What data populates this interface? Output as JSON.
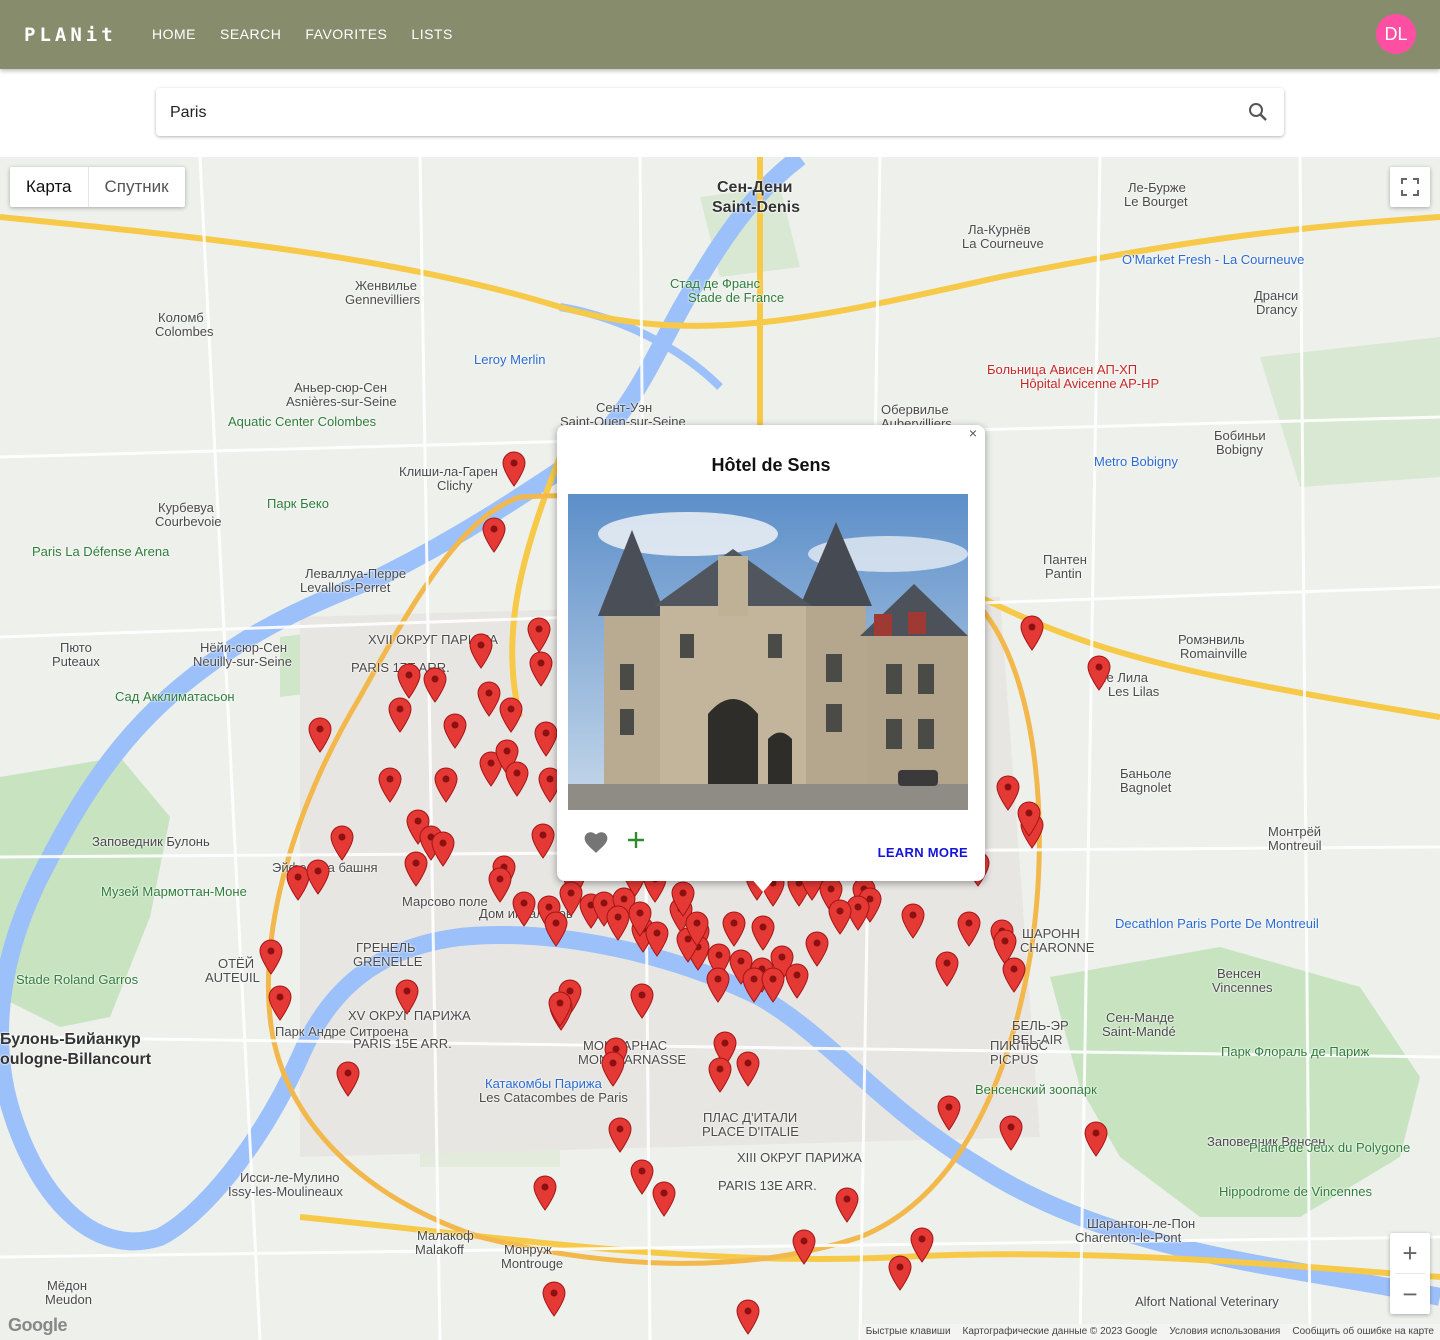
{
  "app": {
    "logo": "PLANit"
  },
  "nav": {
    "items": [
      "HOME",
      "SEARCH",
      "FAVORITES",
      "LISTS"
    ]
  },
  "user": {
    "initials": "DL",
    "avatar_color": "#ff4fa3"
  },
  "search": {
    "value": "Paris"
  },
  "map": {
    "type_buttons": [
      "Карта",
      "Спутник"
    ],
    "active_type": "Карта",
    "attribution": [
      "Быстрые клавиши",
      "Картографические данные © 2023 Google",
      "Условия использования",
      "Сообщить об ошибке на карте"
    ],
    "google_logo": "Google",
    "labels": [
      "Сен-Дени",
      "Saint-Denis",
      "Ле-Бурже",
      "Le Bourget",
      "Ла-Курнёв",
      "La Courneuve",
      "Женвилье",
      "Gennevilliers",
      "Коломб",
      "Colombes",
      "Аньер-сюр-Сен",
      "Asnières-sur-Seine",
      "Сент-Уэн",
      "Saint-Ouen-sur-Seine",
      "Клиши-ла-Гарен",
      "Clichy",
      "Курбевуа",
      "Courbevoie",
      "Леваллуа-Перре",
      "Levallois-Perret",
      "Нёйи-сюр-Сен",
      "Neuilly-sur-Seine",
      "Пюто",
      "Puteaux",
      "Обервилье",
      "Aubervilliers",
      "Бобиньи",
      "Bobigny",
      "Дранси",
      "Drancy",
      "Пантен",
      "Pantin",
      "Ромэнвиль",
      "Romainville",
      "Ле Лила",
      "Les Lilas",
      "Баньоле",
      "Bagnolet",
      "Монтрёй",
      "Montreuil",
      "Венсен",
      "Vincennes",
      "Сен-Манде",
      "Saint-Mandé",
      "Шарантон-ле-Пон",
      "Charenton-le-Pont",
      "Исси-ле-Мулино",
      "Issy-les-Moulineaux",
      "Малакоф",
      "Malakoff",
      "Монруж",
      "Montrouge",
      "Мёдон",
      "Meudon",
      "Булонь-Бийанкур",
      "oulogne-Billancourt",
      "XV ОКРУГ ПАРИЖА",
      "PARIS 15E ARR.",
      "XVII ОКРУГ ПАРИЖА",
      "PARIS 17E ARR.",
      "XIII ОКРУГ ПАРИЖА",
      "PARIS 13E ARR.",
      "ПЛАС Д'ИТАЛИ",
      "PLACE D'ITALIE",
      "МОНПАРНАС",
      "MONTPARNASSE",
      "ГРЕНЕЛЬ",
      "GRENELLE",
      "ОТЁЙ",
      "AUTEUIL",
      "ШАРОНН",
      "CHARONNE",
      "ПИКПЮС",
      "PICPUS",
      "БЕЛЬ-ЭР",
      "BEL-AIR",
      "Заповедник Булонь",
      "Заповедник Венсен",
      "Эйфелева башня",
      "Марсово поле",
      "Дом инвалидов",
      "Катакомбы Парижа",
      "Les Catacombes de Paris",
      "Венсенский зоопарк",
      "Парк Флораль де Париж",
      "Plaine de Jeux du Polygone",
      "Hippodrome de Vincennes",
      "Aquatic Center Colombes",
      "Paris La Défense Arena",
      "Stade Roland Garros",
      "Сад Акклиматасьон",
      "Музей Мармоттан-Моне",
      "Парк Беко",
      "Стад де Франс",
      "Stade de France",
      "Больница Ависен АП-ХП",
      "Hôpital Avicenne AP-HP",
      "Leroy Merlin",
      "Decathlon Paris Porte De Montreuil",
      "O'Market Fresh - La Courneuve",
      "Metro Bobigny",
      "Парк Андре Ситроена",
      "Alfort National Veterinary"
    ]
  },
  "popup": {
    "title": "Hôtel de Sens",
    "close": "×",
    "learn_more": "LEARN MORE",
    "image_alt": "Hôtel de Sens building"
  },
  "colors": {
    "topbar": "#878c6d",
    "pin": "#e53935",
    "learn_more": "#1515d6",
    "add": "#2e8b2e"
  }
}
